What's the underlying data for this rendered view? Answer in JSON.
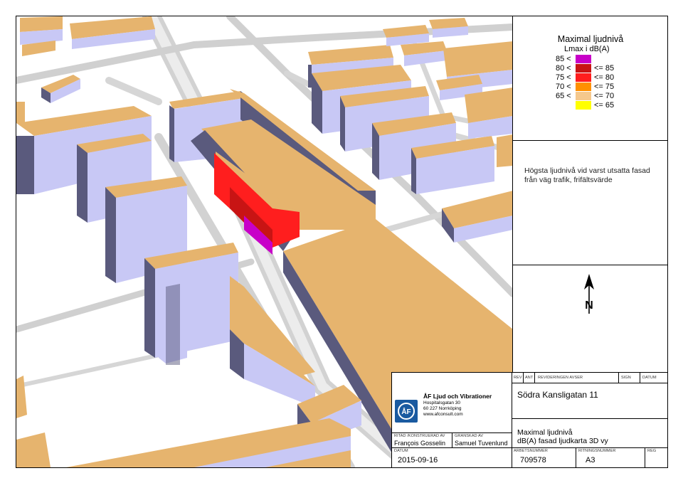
{
  "legend": {
    "title": "Maximal ljudnivå",
    "subtitle": "Lmax i dB(A)",
    "rows": [
      {
        "low": "85 <",
        "high": "",
        "color": "#c800c8"
      },
      {
        "low": "80 <",
        "high": "<= 85",
        "color": "#c81414"
      },
      {
        "low": "75 <",
        "high": "<= 80",
        "color": "#ff1e1e"
      },
      {
        "low": "70 <",
        "high": "<= 75",
        "color": "#ff9000"
      },
      {
        "low": "65 <",
        "high": "<= 70",
        "color": "#f5c88c"
      },
      {
        "low": "",
        "high": "<= 65",
        "color": "#ffff00"
      }
    ]
  },
  "description": "Högsta ljudnivå vid varst utsatta fasad från väg trafik, frifältsvärde",
  "north": {
    "label": "N"
  },
  "company": {
    "name": "ÅF Ljud och Vibrationer",
    "address": "Hospitalsgatan 30",
    "city": "60 227 Norrköping",
    "web": "www.afconsult.com",
    "logo_text": "ÅF"
  },
  "title_block": {
    "rev_label": "REV",
    "ant_label": "ANT",
    "revision_label": "REVIDERINGEN AVSER",
    "sign_label": "SIGN",
    "datum_label": "DATUM",
    "project": "Södra Kansligatan 11",
    "drawn_label": "RITAD /KONSTRUERAD AV",
    "checked_label": "GRANSKAD AV",
    "drawn_by": "François Gosselin",
    "checked_by": "Samuel Tuvenlund",
    "drawing_title_1": "Maximal ljudnivå",
    "drawing_title_2": "dB(A) fasad ljudkarta 3D vy",
    "date_label": "DATUM",
    "date": "2015-09-16",
    "job_label": "ARBETSNUMMER",
    "job": "709578",
    "drawing_no_label": "RITNINGSNUMMER",
    "drawing_no": "A3",
    "reg_label": "REG"
  },
  "colors": {
    "roof": "#e6b46e",
    "wall_light": "#c8c8f5",
    "wall_dark": "#5a5a7d",
    "road": "#d2d2d2"
  }
}
